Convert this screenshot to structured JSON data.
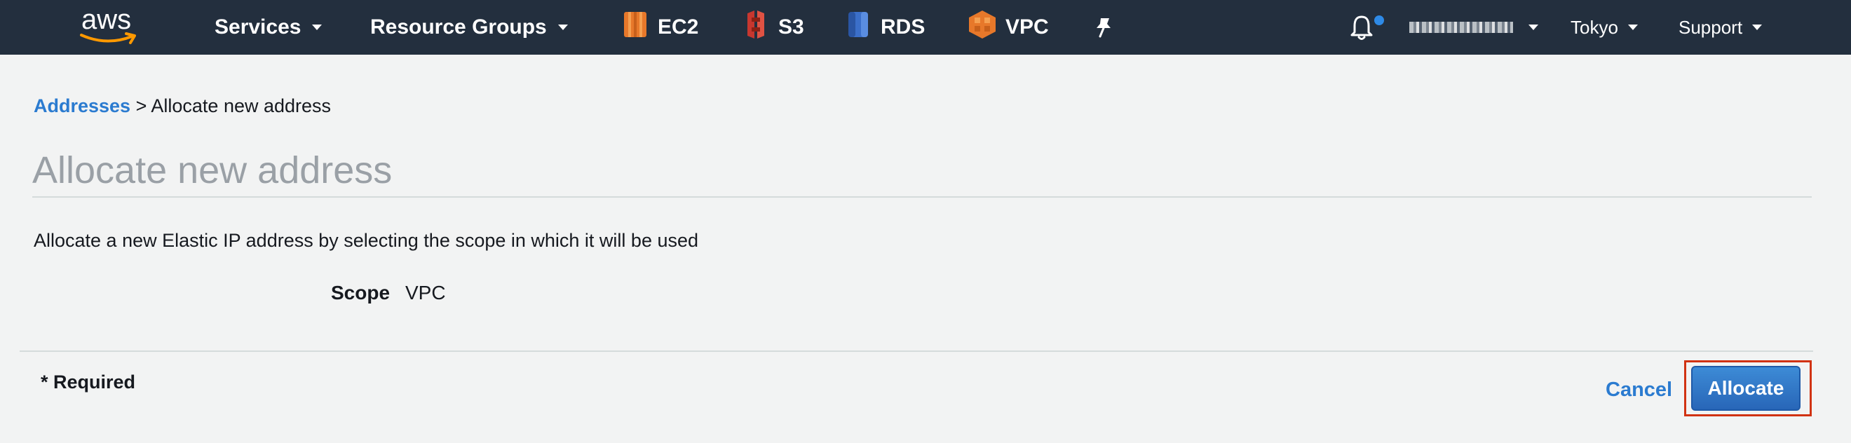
{
  "brand": {
    "logo_text": "aws",
    "nav_bg": "#232f3e",
    "link_color": "#2b7bd0",
    "primary_button": "#2e73c2",
    "highlight_border": "#d13212"
  },
  "nav": {
    "services_label": "Services",
    "resource_groups_label": "Resource Groups",
    "shortcuts": [
      {
        "label": "EC2",
        "icon": "ec2-icon",
        "color": "#e7782a"
      },
      {
        "label": "S3",
        "icon": "s3-icon",
        "color": "#c7372f"
      },
      {
        "label": "RDS",
        "icon": "rds-icon",
        "color": "#3b6fc9"
      },
      {
        "label": "VPC",
        "icon": "vpc-icon",
        "color": "#e7782a"
      }
    ],
    "pin_icon": "pin-icon",
    "notifications_icon": "bell-icon",
    "region_label": "Tokyo",
    "support_label": "Support"
  },
  "breadcrumb": {
    "parent_label": "Addresses",
    "separator": ">",
    "current_label": "Allocate new address"
  },
  "page": {
    "title": "Allocate new address",
    "description": "Allocate a new Elastic IP address by selecting the scope in which it will be used",
    "scope_label": "Scope",
    "scope_value": "VPC",
    "required_note": "* Required"
  },
  "actions": {
    "cancel_label": "Cancel",
    "allocate_label": "Allocate"
  }
}
